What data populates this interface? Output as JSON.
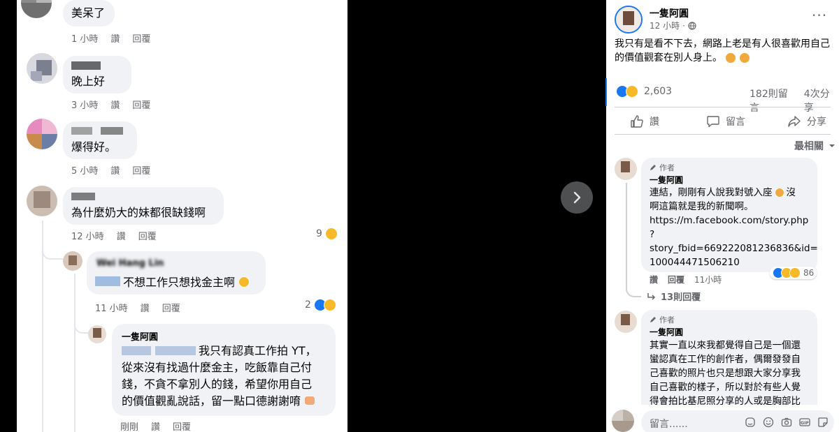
{
  "left_comments": [
    {
      "text": "美呆了",
      "time": "1 小時",
      "like": "讚",
      "reply": "回覆"
    },
    {
      "text": "晚上好",
      "time": "3 小時",
      "like": "讚",
      "reply": "回覆"
    },
    {
      "text": "爆得好。",
      "time": "5 小時",
      "like": "讚",
      "reply": "回覆"
    },
    {
      "text": "為什麼奶大的妹都很缺錢啊",
      "time": "12 小時",
      "like": "讚",
      "reply": "回覆",
      "reaction_count": "9"
    }
  ],
  "reply_1": {
    "author": "Wei Hang Lin",
    "text": "不想工作只想找金主啊",
    "time": "11 小時",
    "like": "讚",
    "reply": "回覆",
    "reaction_count": "2"
  },
  "reply_2": {
    "author": "一隻阿圓",
    "lines": [
      "我只有認真工作拍 YT，",
      "從來沒有找過什麼金主，吃飯靠自己付",
      "錢，不貪不拿別人的錢，希望你用自己",
      "的價值觀亂說話，留一點口德謝謝唷"
    ],
    "time": "剛剛",
    "like": "讚",
    "reply": "回覆"
  },
  "post": {
    "author": "一隻阿圓",
    "time": "12 小時",
    "body_lines": [
      "我只有是看不下去，網路上老是有人很喜歡用自己",
      "的價值觀套在別人身上。"
    ],
    "reaction_count": "2,603",
    "comment_count": "182則留言",
    "share_count": "4次分享",
    "actions": {
      "like": "讚",
      "comment": "留言",
      "share": "分享"
    },
    "sort_label": "最相關"
  },
  "right_comment_1": {
    "badge": "作者",
    "author": "一隻阿圓",
    "lines": [
      "連結，剛剛有人說我對號入座",
      "沒",
      "啊這篇就是我的新聞啊。",
      "https://m.facebook.com/story.php",
      "?",
      "story_fbid=669222081236836&id=",
      "100044471506210"
    ],
    "reaction_count": "86",
    "like": "讚",
    "reply": "回覆",
    "time": "11小時",
    "replies_link": "13則回覆"
  },
  "right_comment_2": {
    "badge": "作者",
    "author": "一隻阿圓",
    "lines": [
      "其實一直以來我都覺得自己是一個還",
      "蠻認真在工作的創作者，偶爾發發自",
      "己喜歡的照片也只是想跟大家分享我",
      "自己喜歡的樣子，所以對於有些人覺",
      "得會拍比基尼照分享的人或是胸部比"
    ]
  },
  "composer": {
    "placeholder": "留言......"
  },
  "colors": {
    "accent": "#1877f2",
    "bubble": "#f0f2f5",
    "meta": "#65676b"
  }
}
